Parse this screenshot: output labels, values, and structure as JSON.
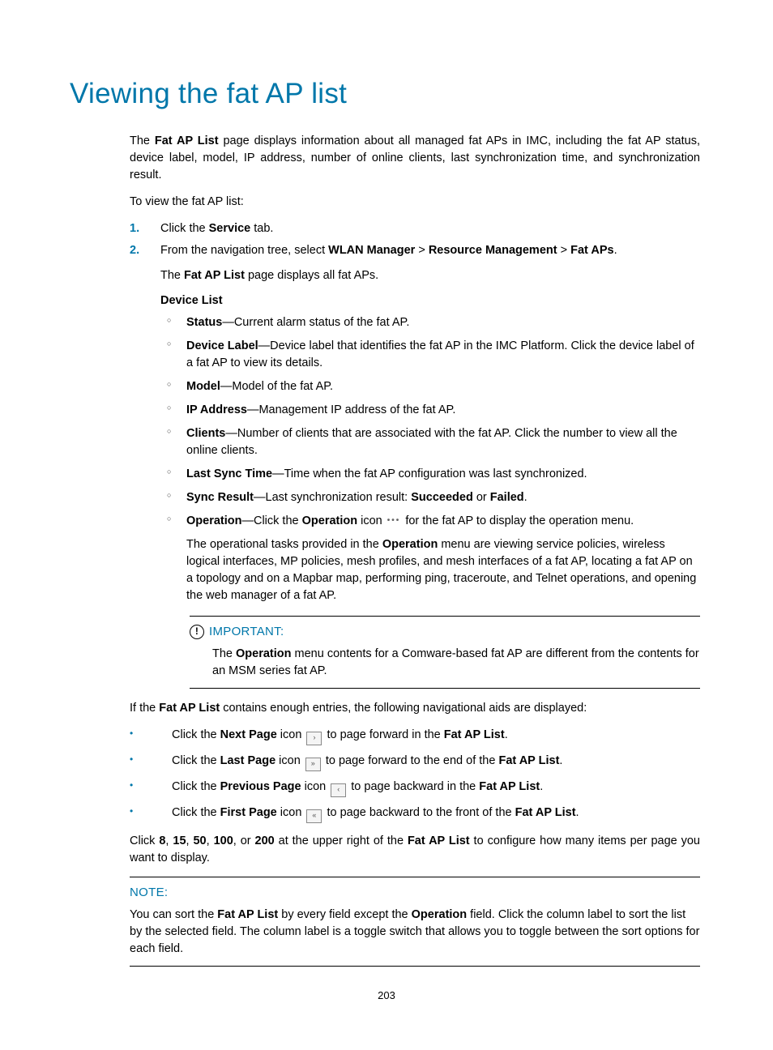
{
  "title": "Viewing the fat AP list",
  "intro": {
    "pre": "The ",
    "b1": "Fat AP List",
    "post": " page displays information about all managed fat APs in IMC, including the fat AP status, device label, model, IP address, number of online clients, last synchronization time, and synchronization result."
  },
  "to_view": "To view the fat AP list:",
  "steps": {
    "s1": {
      "pre": "Click the ",
      "b1": "Service",
      "post": " tab."
    },
    "s2": {
      "pre": "From the navigation tree, select ",
      "b1": "WLAN Manager",
      "sep1": " > ",
      "b2": "Resource Management",
      "sep2": " > ",
      "b3": "Fat APs",
      "post": "."
    },
    "s2_sub": {
      "pre": "The ",
      "b1": "Fat AP List",
      "post": " page displays all fat APs."
    },
    "device_list_label": "Device List"
  },
  "fields": {
    "status": {
      "name": "Status",
      "desc": "—Current alarm status of the fat AP."
    },
    "label": {
      "name": "Device Label",
      "desc": "—Device label that identifies the fat AP in the IMC Platform. Click the device label of a fat AP to view its details."
    },
    "model": {
      "name": "Model",
      "desc": "—Model of the fat AP."
    },
    "ip": {
      "name": "IP Address",
      "desc": "—Management IP address of the fat AP."
    },
    "clients": {
      "name": "Clients",
      "desc": "—Number of clients that are associated with the fat AP. Click the number to view all the online clients."
    },
    "lastsync": {
      "name": "Last Sync Time",
      "desc": "—Time when the fat AP configuration was last synchronized."
    },
    "syncres": {
      "name": "Sync Result",
      "pre": "—Last synchronization result: ",
      "b1": "Succeeded",
      "mid": " or ",
      "b2": "Failed",
      "post": "."
    },
    "operation": {
      "name": "Operation",
      "pre": "—Click the ",
      "b1": "Operation",
      "mid": " icon ",
      "post": " for the fat AP to display the operation menu.",
      "extra_pre": "The operational tasks provided in the ",
      "extra_b1": "Operation",
      "extra_post": " menu are viewing service policies, wireless logical interfaces, MP policies, mesh profiles, and mesh interfaces of a fat AP, locating a fat AP on a topology and on a Mapbar map, performing ping, traceroute, and Telnet operations, and opening the web manager of a fat AP."
    }
  },
  "important": {
    "label": "IMPORTANT:",
    "pre": "The ",
    "b1": "Operation",
    "post": " menu contents for a Comware-based fat AP are different from the contents for an MSM series fat AP."
  },
  "nav_intro": {
    "pre": "If the ",
    "b1": "Fat AP List",
    "post": " contains enough entries, the following navigational aids are displayed:"
  },
  "nav": {
    "next": {
      "pre": "Click the ",
      "b1": "Next Page",
      "mid": " icon ",
      "post1": " to page forward in the ",
      "b2": "Fat AP List",
      "post2": "."
    },
    "last": {
      "pre": "Click the ",
      "b1": "Last Page",
      "mid": " icon ",
      "post1": " to page forward to the end of the ",
      "b2": "Fat AP List",
      "post2": "."
    },
    "prev": {
      "pre": "Click the ",
      "b1": "Previous Page",
      "mid": " icon ",
      "post1": " to page backward in the ",
      "b2": "Fat AP List",
      "post2": "."
    },
    "first": {
      "pre": "Click the ",
      "b1": "First Page",
      "mid": " icon ",
      "post1": " to page backward to the front of the ",
      "b2": "Fat AP List",
      "post2": "."
    }
  },
  "pager": {
    "pre": "Click ",
    "n1": "8",
    "c1": ", ",
    "n2": "15",
    "c2": ", ",
    "n3": "50",
    "c3": ", ",
    "n4": "100",
    "c4": ", or ",
    "n5": "200",
    "mid": " at the upper right of the ",
    "b1": "Fat AP List",
    "post": " to configure how many items per page you want to display."
  },
  "note": {
    "label": "NOTE:",
    "pre": "You can sort the ",
    "b1": "Fat AP List",
    "mid": " by every field except the ",
    "b2": "Operation",
    "post": " field. Click the column label to sort the list by the selected field. The column label is a toggle switch that allows you to toggle between the sort options for each field."
  },
  "page_number": "203"
}
